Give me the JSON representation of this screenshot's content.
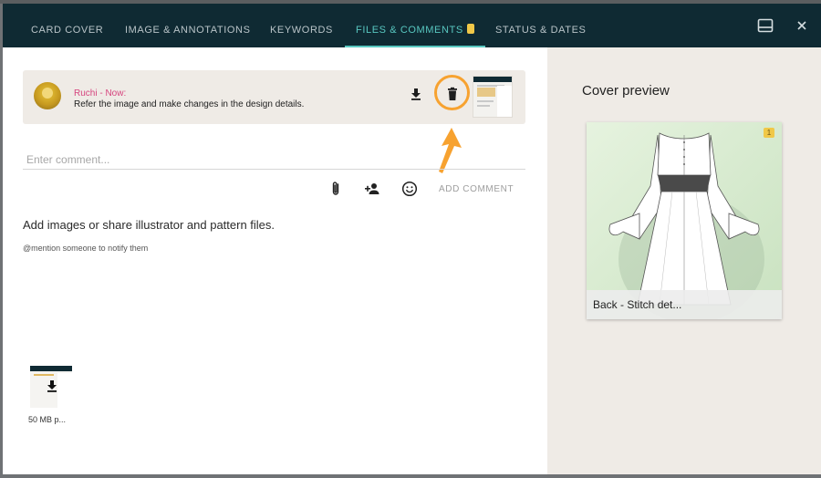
{
  "tabs": [
    {
      "label": "CARD COVER"
    },
    {
      "label": "IMAGE & ANNOTATIONS"
    },
    {
      "label": "KEYWORDS"
    },
    {
      "label": "FILES & COMMENTS",
      "badge": true
    },
    {
      "label": "STATUS & DATES"
    }
  ],
  "active_tab": "FILES & COMMENTS",
  "header_icons": [
    "panel-toggle-icon",
    "close-icon"
  ],
  "comment": {
    "author_line": "Ruchi - Now:",
    "text": "Refer the image and make changes in the design details.",
    "actions": [
      "download-icon",
      "delete-icon"
    ]
  },
  "composer": {
    "placeholder": "Enter comment...",
    "tools": [
      "attach-icon",
      "add-person-icon",
      "emoji-icon"
    ],
    "submit_label": "ADD COMMENT"
  },
  "files": {
    "hint_title": "Add images or share illustrator and pattern files.",
    "hint_sub": "@mention someone to notify them",
    "items": [
      {
        "name": "50 MB p..."
      }
    ]
  },
  "cover": {
    "title": "Cover preview",
    "caption": "Back - Stitch det...",
    "badge": "1"
  },
  "colors": {
    "header_bg": "#0f2a33",
    "active_tab": "#58c7c0",
    "author": "#d6447e",
    "highlight": "#f7a230",
    "panel_bg": "#efebe6"
  }
}
